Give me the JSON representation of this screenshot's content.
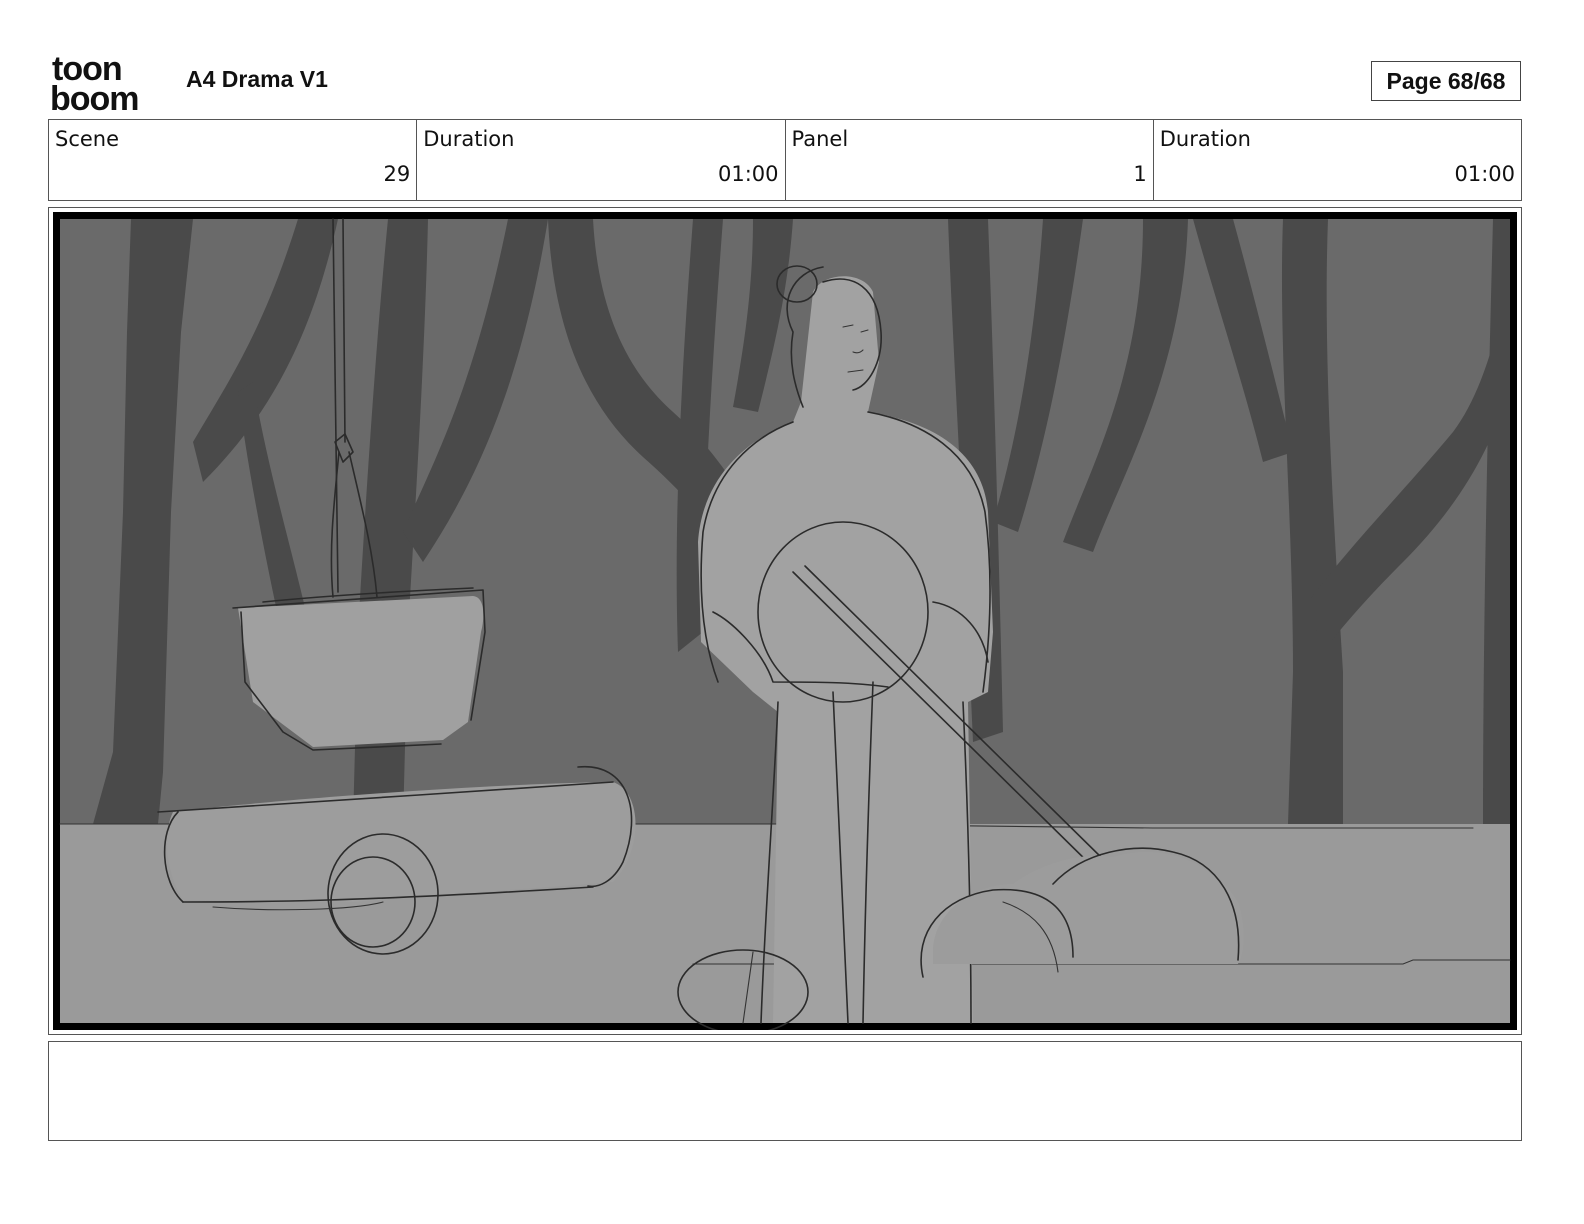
{
  "header": {
    "logo_line1": "toon",
    "logo_line2": "boom",
    "title": "A4 Drama V1",
    "page": "Page 68/68"
  },
  "info": [
    {
      "label": "Scene",
      "value": "29"
    },
    {
      "label": "Duration",
      "value": "01:00"
    },
    {
      "label": "Panel",
      "value": "1"
    },
    {
      "label": "Duration",
      "value": "01:00"
    }
  ],
  "panel": {
    "colors": {
      "frame": "#000000",
      "background": "#6a6a6a",
      "trees": "#4a4a4a",
      "ground": "#9a9a9a",
      "figure": "#a2a2a2"
    }
  },
  "notes": ""
}
